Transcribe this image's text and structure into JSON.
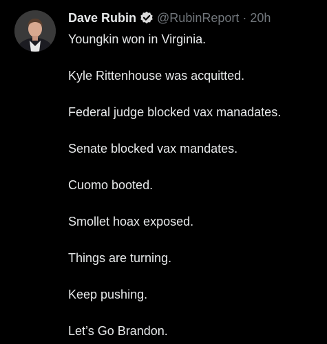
{
  "tweet": {
    "author": {
      "name": "Dave Rubin",
      "handle": "@RubinReport",
      "verified": true
    },
    "separator": "·",
    "time": "20h",
    "lines": [
      "Youngkin won in Virginia.",
      "Kyle Rittenhouse was acquitted.",
      "Federal judge blocked vax manadates.",
      "Senate blocked vax mandates.",
      "Cuomo booted.",
      "Smollet hoax exposed.",
      "Things are turning.",
      "Keep pushing.",
      "Let’s Go Brandon."
    ]
  },
  "icons": {
    "avatar": "avatar",
    "badge": "verified-badge-icon"
  },
  "colors": {
    "background": "#000000",
    "text": "#e7e9ea",
    "muted": "#71767b",
    "badge": "#d9d9d9"
  }
}
